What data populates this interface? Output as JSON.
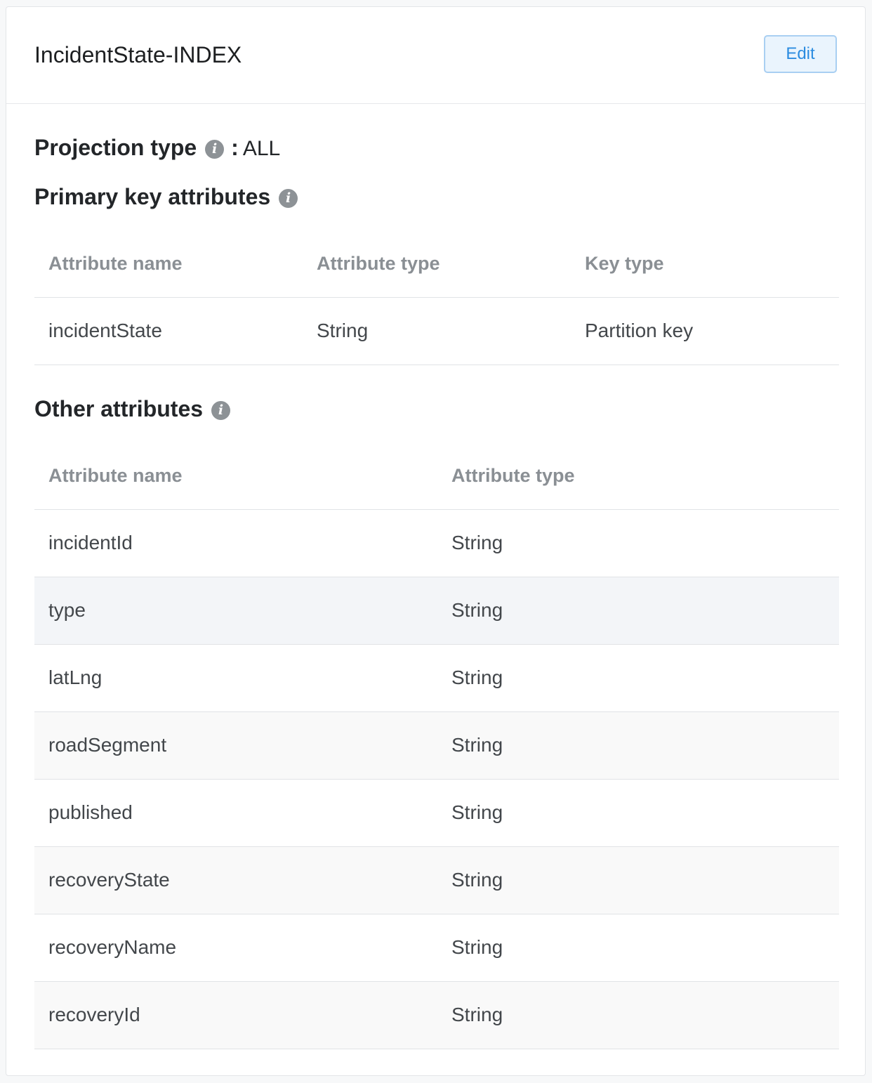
{
  "header": {
    "title": "IncidentState-INDEX",
    "edit_label": "Edit"
  },
  "projection": {
    "label": "Projection type",
    "colon": ":",
    "value": "ALL",
    "info_icon": "info-icon"
  },
  "primary_key": {
    "title": "Primary key attributes",
    "info_icon": "info-icon",
    "columns": [
      "Attribute name",
      "Attribute type",
      "Key type"
    ],
    "rows": [
      {
        "name": "incidentState",
        "type": "String",
        "key_type": "Partition key"
      }
    ]
  },
  "other_attributes": {
    "title": "Other attributes",
    "info_icon": "info-icon",
    "columns": [
      "Attribute name",
      "Attribute type"
    ],
    "rows": [
      {
        "name": "incidentId",
        "type": "String"
      },
      {
        "name": "type",
        "type": "String"
      },
      {
        "name": "latLng",
        "type": "String"
      },
      {
        "name": "roadSegment",
        "type": "String"
      },
      {
        "name": "published",
        "type": "String"
      },
      {
        "name": "recoveryState",
        "type": "String"
      },
      {
        "name": "recoveryName",
        "type": "String"
      },
      {
        "name": "recoveryId",
        "type": "String"
      }
    ]
  },
  "colors": {
    "accent": "#2c8ce0",
    "button_bg": "#eaf4fd",
    "row_hover": "#f3f5f8",
    "row_alt": "#f9f9f9"
  }
}
